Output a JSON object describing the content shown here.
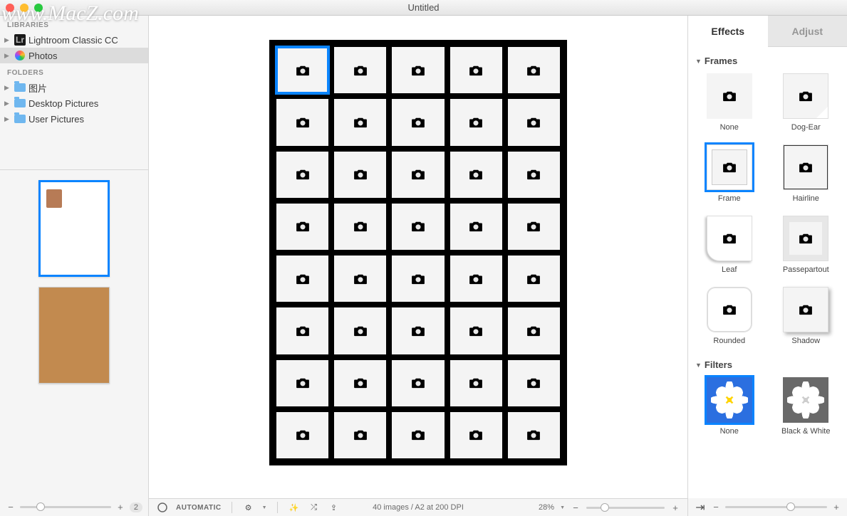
{
  "window": {
    "title": "Untitled"
  },
  "watermark": "www.MacZ.com",
  "sidebar": {
    "sections": {
      "libraries_label": "LIBRARIES",
      "libraries": [
        {
          "label": "Lightroom Classic CC",
          "icon": "lr"
        },
        {
          "label": "Photos",
          "icon": "photos",
          "selected": true
        }
      ],
      "folders_label": "FOLDERS",
      "folders": [
        {
          "label": "图片"
        },
        {
          "label": "Desktop Pictures"
        },
        {
          "label": "User Pictures"
        }
      ]
    },
    "page_count_badge": "2"
  },
  "canvas": {
    "cols": 5,
    "rows": 8,
    "selected_index": 0,
    "image_count": 40
  },
  "inspector": {
    "tabs": {
      "effects": "Effects",
      "adjust": "Adjust",
      "active": "effects"
    },
    "frames_label": "Frames",
    "frames": [
      {
        "id": "none",
        "label": "None"
      },
      {
        "id": "dogear",
        "label": "Dog-Ear"
      },
      {
        "id": "frame",
        "label": "Frame",
        "selected": true
      },
      {
        "id": "hairline",
        "label": "Hairline"
      },
      {
        "id": "leaf",
        "label": "Leaf"
      },
      {
        "id": "passe",
        "label": "Passepartout"
      },
      {
        "id": "rounded",
        "label": "Rounded"
      },
      {
        "id": "shadow",
        "label": "Shadow"
      }
    ],
    "filters_label": "Filters",
    "filters": [
      {
        "id": "none",
        "label": "None",
        "selected": true
      },
      {
        "id": "bw",
        "label": "Black & White"
      }
    ]
  },
  "footer": {
    "layout_mode": "AUTOMATIC",
    "info": "40 images / A2 at 200 DPI",
    "zoom_label": "28%",
    "zoom_value": 0.18
  }
}
